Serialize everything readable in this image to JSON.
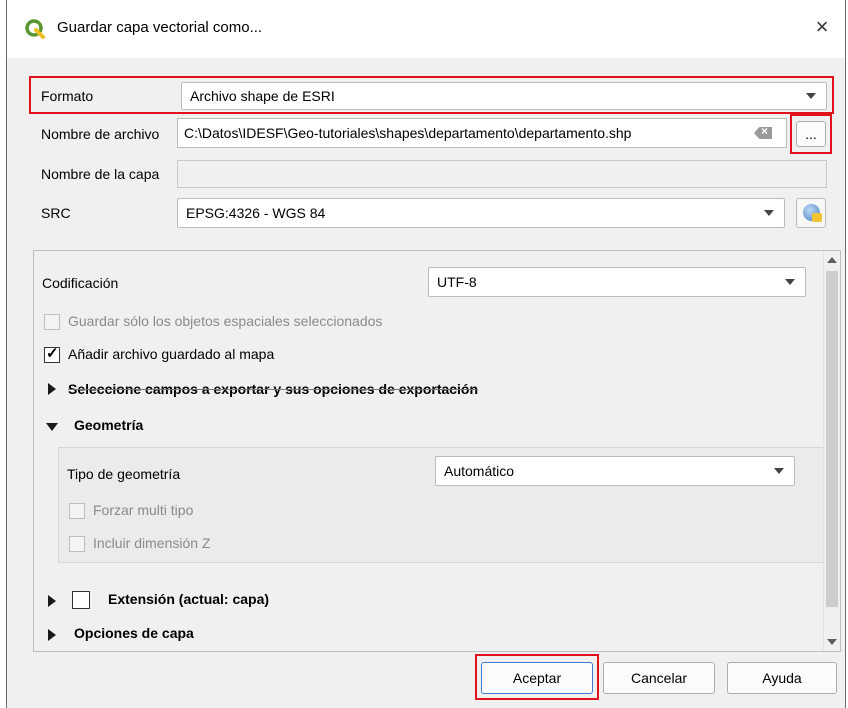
{
  "window": {
    "title": "Guardar capa vectorial como...",
    "close_symbol": "×"
  },
  "form": {
    "format_label": "Formato",
    "format_value": "Archivo shape de ESRI",
    "filename_label": "Nombre de archivo",
    "filename_value": "C:\\Datos\\IDESF\\Geo-tutoriales\\shapes\\departamento\\departamento.shp",
    "browse_label": "...",
    "layername_label": "Nombre de la capa",
    "layername_value": "",
    "crs_label": "SRC",
    "crs_value": "EPSG:4326 - WGS 84"
  },
  "options": {
    "encoding_label": "Codificación",
    "encoding_value": "UTF-8",
    "save_selected_label": "Guardar sólo los objetos espaciales seleccionados",
    "save_selected_checked": false,
    "add_to_map_label": "Añadir archivo guardado al mapa",
    "add_to_map_checked": true,
    "fields_section_label": "Seleccione campos a exportar y sus opciones de exportación",
    "geometry_section_label": "Geometría",
    "geometry_type_label": "Tipo de geometría",
    "geometry_type_value": "Automático",
    "force_multi_label": "Forzar multi tipo",
    "include_z_label": "Incluir dimensión Z",
    "extent_label": "Extensión (actual: capa)",
    "layer_options_label": "Opciones de capa"
  },
  "buttons": {
    "ok": "Aceptar",
    "cancel": "Cancelar",
    "help": "Ayuda"
  },
  "colors": {
    "highlight": "#e0131b",
    "qgis_green": "#589632",
    "qgis_yellow": "#eebf1f"
  },
  "icons": [
    "qgis-logo-icon",
    "close-icon",
    "dropdown-arrow-icon",
    "clear-text-icon",
    "crs-globe-icon",
    "expand-arrow-icon",
    "collapse-arrow-icon",
    "checkmark-icon",
    "scroll-up-icon",
    "scroll-down-icon"
  ]
}
